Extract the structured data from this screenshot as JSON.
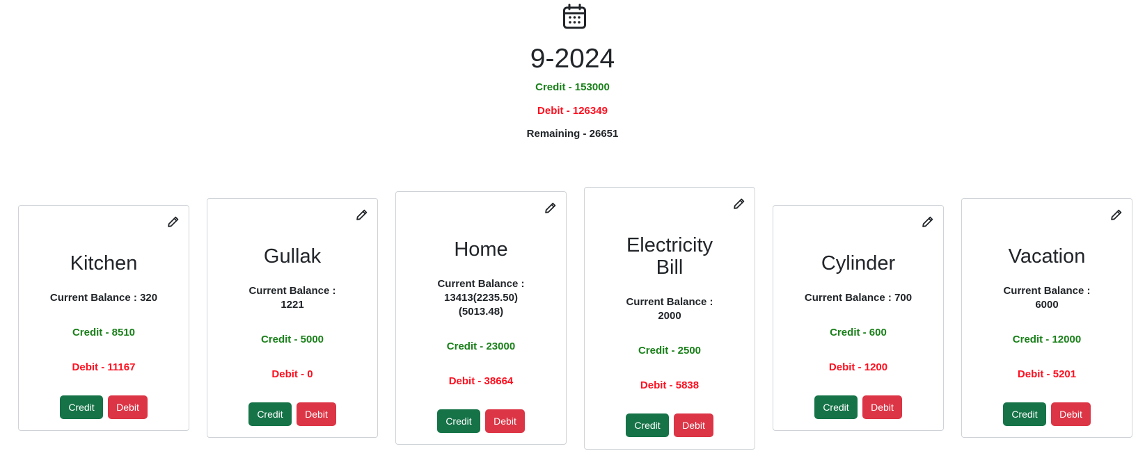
{
  "summary": {
    "calendar_icon": "calendar-icon",
    "month": "9-2024",
    "credit": "Credit - 153000",
    "debit": "Debit - 126349",
    "remaining": "Remaining - 26651"
  },
  "colors": {
    "credit_text": "#198019",
    "debit_text": "#ff0f1f",
    "credit_button": "#157347",
    "debit_button": "#dc3545"
  },
  "cards": [
    {
      "title": "Kitchen",
      "balance": "Current Balance : 320",
      "credit": "Credit - 8510",
      "debit": "Debit - 11167",
      "credit_button": "Credit",
      "debit_button": "Debit",
      "edit_icon": "pencil-icon"
    },
    {
      "title": "Gullak",
      "balance": "Current Balance : 1221",
      "credit": "Credit - 5000",
      "debit": "Debit - 0",
      "credit_button": "Credit",
      "debit_button": "Debit",
      "edit_icon": "pencil-icon"
    },
    {
      "title": "Home",
      "balance": "Current Balance : 13413(2235.50)(5013.48)",
      "credit": "Credit - 23000",
      "debit": "Debit - 38664",
      "credit_button": "Credit",
      "debit_button": "Debit",
      "edit_icon": "pencil-icon"
    },
    {
      "title": "Electricity Bill",
      "balance": "Current Balance : 2000",
      "credit": "Credit - 2500",
      "debit": "Debit - 5838",
      "credit_button": "Credit",
      "debit_button": "Debit",
      "edit_icon": "pencil-icon"
    },
    {
      "title": "Cylinder",
      "balance": "Current Balance : 700",
      "credit": "Credit - 600",
      "debit": "Debit - 1200",
      "credit_button": "Credit",
      "debit_button": "Debit",
      "edit_icon": "pencil-icon"
    },
    {
      "title": "Vacation",
      "balance": "Current Balance : 6000",
      "credit": "Credit - 12000",
      "debit": "Debit - 5201",
      "credit_button": "Credit",
      "debit_button": "Debit",
      "edit_icon": "pencil-icon"
    }
  ]
}
